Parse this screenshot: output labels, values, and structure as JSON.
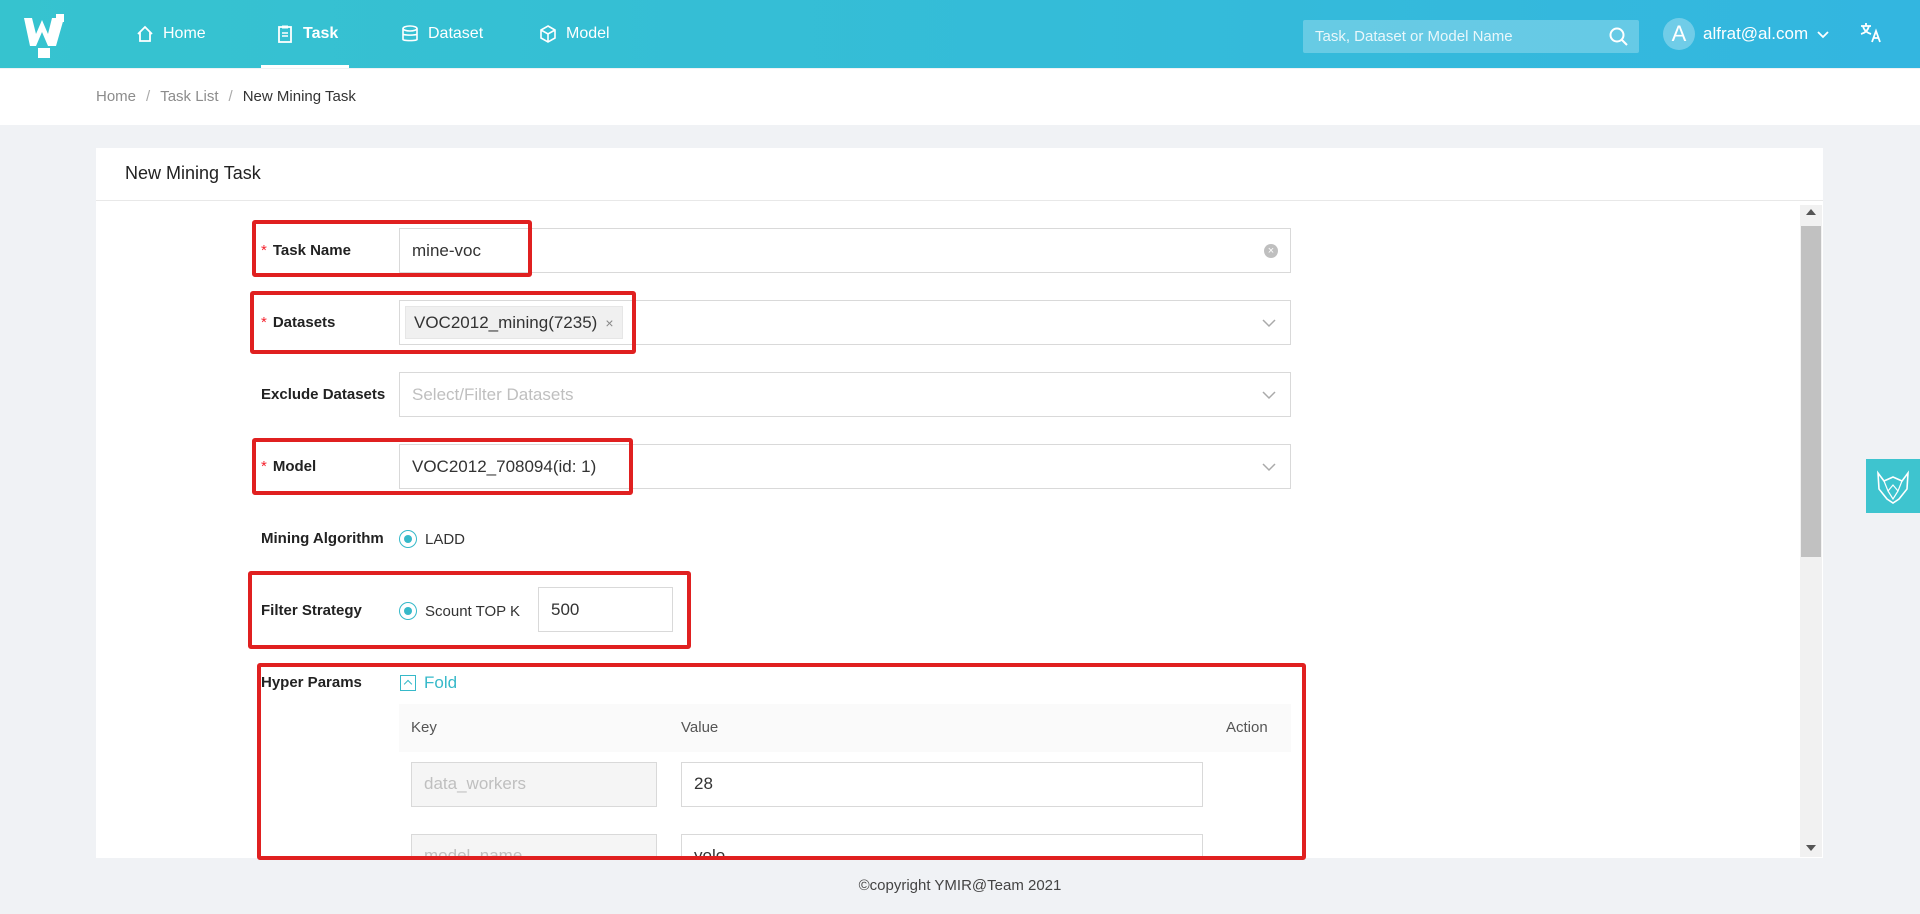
{
  "header": {
    "nav": [
      {
        "label": "Home",
        "icon": "home-icon"
      },
      {
        "label": "Task",
        "icon": "clipboard-icon",
        "active": true
      },
      {
        "label": "Dataset",
        "icon": "database-icon"
      },
      {
        "label": "Model",
        "icon": "cube-icon"
      }
    ],
    "search_placeholder": "Task, Dataset or Model Name",
    "avatar_letter": "A",
    "user_email": "alfrat@al.com"
  },
  "breadcrumb": [
    "Home",
    "Task List",
    "New Mining Task"
  ],
  "card_title": "New Mining Task",
  "form": {
    "task_name": {
      "label": "Task Name",
      "value": "mine-voc"
    },
    "datasets": {
      "label": "Datasets",
      "tag": "VOC2012_mining(7235)"
    },
    "exclude_datasets": {
      "label": "Exclude Datasets",
      "placeholder": "Select/Filter Datasets"
    },
    "model": {
      "label": "Model",
      "value": "VOC2012_708094(id: 1)"
    },
    "mining_algorithm": {
      "label": "Mining Algorithm",
      "option": "LADD"
    },
    "filter_strategy": {
      "label": "Filter Strategy",
      "option": "Scount TOP K",
      "value": "500"
    },
    "hyper_params": {
      "label": "Hyper Params",
      "fold_label": "Fold",
      "columns": [
        "Key",
        "Value",
        "Action"
      ],
      "rows": [
        {
          "key": "data_workers",
          "value": "28"
        },
        {
          "key": "model_name",
          "value": "yolo"
        }
      ]
    }
  },
  "footer": "©copyright YMIR@Team 2021",
  "colors": {
    "accent": "#36b9c9",
    "highlight": "#e02020",
    "required": "#f5222d"
  }
}
